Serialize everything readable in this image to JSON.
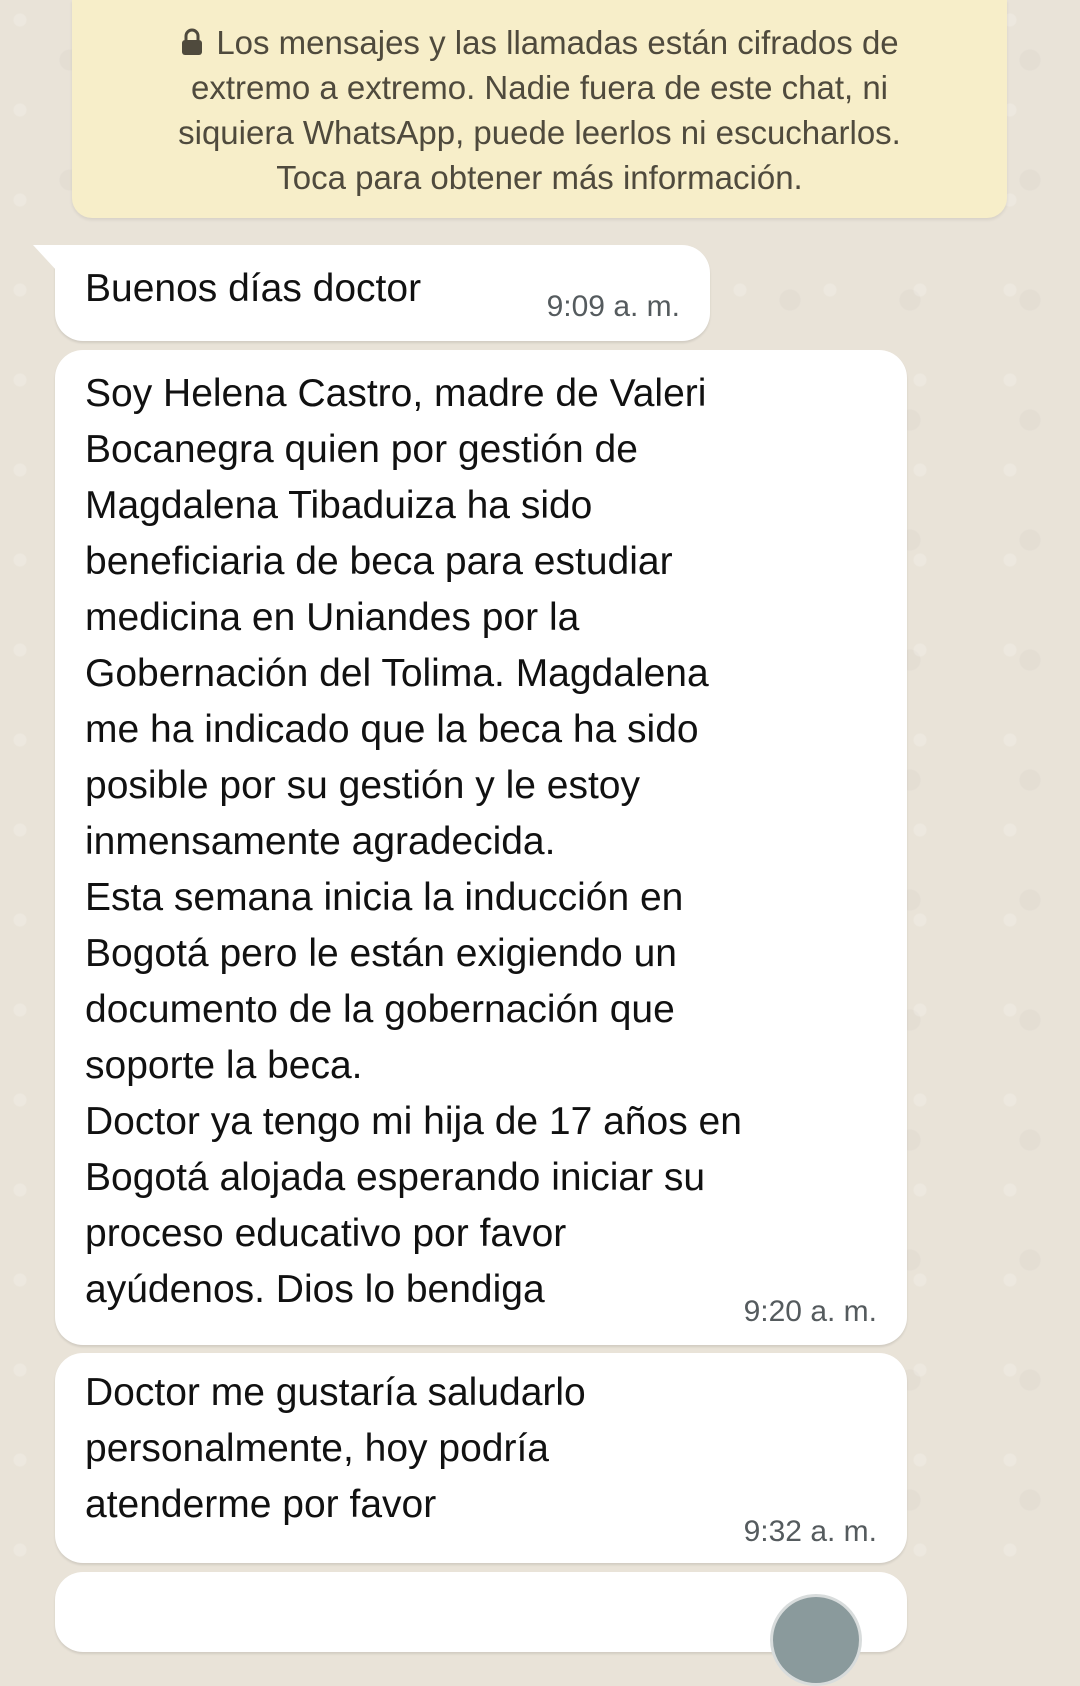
{
  "encryption_notice": {
    "lines": [
      "Los mensajes y las llamadas están cifrados de",
      "extremo a extremo. Nadie fuera de este chat, ni",
      "siquiera WhatsApp, puede leerlos ni escucharlos.",
      "Toca para obtener más información."
    ],
    "icon": "lock-icon"
  },
  "messages": [
    {
      "lines": [
        "Buenos días doctor"
      ],
      "time": "9:09 a. m."
    },
    {
      "lines": [
        "Soy Helena Castro, madre de Valeri",
        "Bocanegra quien por gestión de",
        "Magdalena Tibaduiza ha sido",
        "beneficiaria de beca para estudiar",
        "medicina en Uniandes por la",
        "Gobernación del Tolima. Magdalena",
        "me ha indicado que la beca ha sido",
        "posible por su gestión y le estoy",
        "inmensamente agradecida.",
        "Esta semana inicia la inducción en",
        "Bogotá pero le están exigiendo un",
        "documento de la gobernación que",
        "soporte la beca.",
        "Doctor ya tengo mi hija de 17 años en",
        "Bogotá alojada esperando iniciar su",
        "proceso educativo por favor",
        "ayúdenos. Dios lo bendiga"
      ],
      "time": "9:20 a. m."
    },
    {
      "lines": [
        "Doctor me gustaría saludarlo",
        "personalmente, hoy podría",
        "atenderme por favor"
      ],
      "time": "9:32 a. m."
    }
  ],
  "colors": {
    "background": "#e9e3d8",
    "notice_bg": "#f7eec9",
    "bubble_bg": "#ffffff",
    "time_text": "#555b5e"
  }
}
